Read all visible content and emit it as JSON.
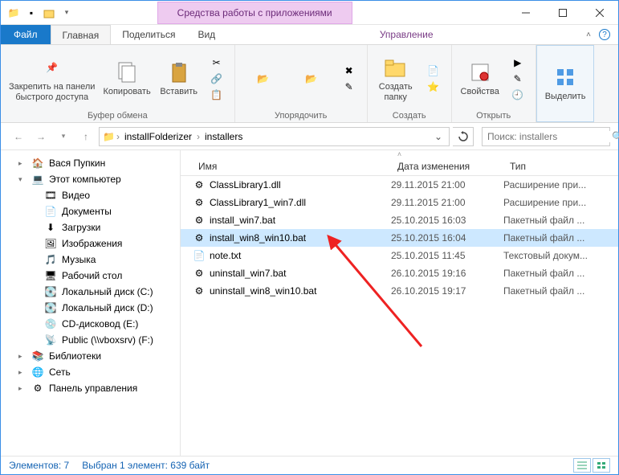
{
  "titlebar": {
    "contextual_title": "Средства работы с приложениями"
  },
  "tabs": {
    "file": "Файл",
    "home": "Главная",
    "share": "Поделиться",
    "view": "Вид",
    "manage": "Управление"
  },
  "ribbon": {
    "clipboard": {
      "pin": "Закрепить на панели\nбыстрого доступа",
      "copy": "Копировать",
      "paste": "Вставить",
      "group": "Буфер обмена"
    },
    "organize": {
      "group": "Упорядочить"
    },
    "new": {
      "newfolder": "Создать\nпапку",
      "group": "Создать"
    },
    "open": {
      "properties": "Свойства",
      "group": "Открыть"
    },
    "select": {
      "selectall": "Выделить",
      "group": ""
    }
  },
  "breadcrumb": {
    "seg1": "installFolderizer",
    "seg2": "installers"
  },
  "search": {
    "placeholder": "Поиск: installers"
  },
  "tree": [
    {
      "icon": "home",
      "label": "Вася Пупкин",
      "indent": 0
    },
    {
      "icon": "pc",
      "label": "Этот компьютер",
      "indent": 0,
      "expanded": true
    },
    {
      "icon": "video",
      "label": "Видео",
      "indent": 1
    },
    {
      "icon": "docs",
      "label": "Документы",
      "indent": 1
    },
    {
      "icon": "downloads",
      "label": "Загрузки",
      "indent": 1
    },
    {
      "icon": "pictures",
      "label": "Изображения",
      "indent": 1
    },
    {
      "icon": "music",
      "label": "Музыка",
      "indent": 1
    },
    {
      "icon": "desktop",
      "label": "Рабочий стол",
      "indent": 1
    },
    {
      "icon": "disk",
      "label": "Локальный диск (C:)",
      "indent": 1
    },
    {
      "icon": "disk",
      "label": "Локальный диск (D:)",
      "indent": 1
    },
    {
      "icon": "cd",
      "label": "CD-дисковод (E:)",
      "indent": 1
    },
    {
      "icon": "netdrive",
      "label": "Public (\\\\vboxsrv) (F:)",
      "indent": 1
    },
    {
      "icon": "libs",
      "label": "Библиотеки",
      "indent": 0
    },
    {
      "icon": "network",
      "label": "Сеть",
      "indent": 0
    },
    {
      "icon": "cpanel",
      "label": "Панель управления",
      "indent": 0
    }
  ],
  "columns": {
    "name": "Имя",
    "date": "Дата изменения",
    "type": "Тип"
  },
  "files": [
    {
      "icon": "dll",
      "name": "ClassLibrary1.dll",
      "date": "29.11.2015 21:00",
      "type": "Расширение при...",
      "selected": false
    },
    {
      "icon": "dll",
      "name": "ClassLibrary1_win7.dll",
      "date": "29.11.2015 21:00",
      "type": "Расширение при...",
      "selected": false
    },
    {
      "icon": "bat",
      "name": "install_win7.bat",
      "date": "25.10.2015 16:03",
      "type": "Пакетный файл ...",
      "selected": false
    },
    {
      "icon": "bat",
      "name": "install_win8_win10.bat",
      "date": "25.10.2015 16:04",
      "type": "Пакетный файл ...",
      "selected": true
    },
    {
      "icon": "txt",
      "name": "note.txt",
      "date": "25.10.2015 11:45",
      "type": "Текстовый докум...",
      "selected": false
    },
    {
      "icon": "bat",
      "name": "uninstall_win7.bat",
      "date": "26.10.2015 19:16",
      "type": "Пакетный файл ...",
      "selected": false
    },
    {
      "icon": "bat",
      "name": "uninstall_win8_win10.bat",
      "date": "26.10.2015 19:17",
      "type": "Пакетный файл ...",
      "selected": false
    }
  ],
  "status": {
    "count": "Элементов: 7",
    "selection": "Выбран 1 элемент: 639 байт"
  }
}
